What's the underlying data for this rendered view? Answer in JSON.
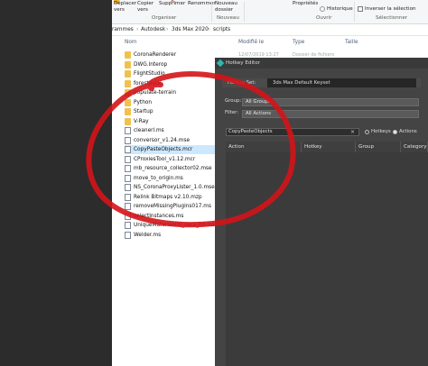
{
  "ribbon": {
    "move_to": "Déplacer\nvers",
    "copy_to": "Copier\nvers",
    "delete": "Supprimer",
    "rename": "Renommer",
    "new_folder": "Nouveau\ndossier",
    "properties": "Propriétés",
    "history": "Historique",
    "invert_selection": "Inverser la sélection",
    "group_organize": "Organiser",
    "group_new": "Nouveau",
    "group_open": "Ouvrir",
    "group_select": "Sélectionner"
  },
  "address": {
    "parts": [
      "rammes",
      "Autodesk",
      "3ds Max 2020",
      "scripts"
    ]
  },
  "columns": {
    "name": "Nom",
    "modified": "Modifié le",
    "type": "Type",
    "size": "Taille"
  },
  "faint_meta": {
    "date": "12/07/2019 13:27",
    "type": "Dossier de fichiers"
  },
  "files": [
    {
      "name": "CoronaRenderer",
      "kind": "folder"
    },
    {
      "name": "DWG.Interop",
      "kind": "folder"
    },
    {
      "name": "FlightStudio",
      "kind": "folder"
    },
    {
      "name": "forestpack",
      "kind": "folder"
    },
    {
      "name": "populate-terrain",
      "kind": "folder"
    },
    {
      "name": "Python",
      "kind": "folder"
    },
    {
      "name": "Startup",
      "kind": "folder"
    },
    {
      "name": "V-Ray",
      "kind": "folder"
    },
    {
      "name": "cleanerl.ms",
      "kind": "file"
    },
    {
      "name": "conversor_v1.24.mse",
      "kind": "file"
    },
    {
      "name": "CopyPasteObjects.mcr",
      "kind": "file"
    },
    {
      "name": "CProxiesTool_v1.12.mcr",
      "kind": "file"
    },
    {
      "name": "mb_resource_collector02.mse",
      "kind": "file"
    },
    {
      "name": "move_to_origin.ms",
      "kind": "file"
    },
    {
      "name": "NS_CoronaProxyLister_1.0.mse",
      "kind": "file"
    },
    {
      "name": "Relink Bitmaps v2.10.mzp",
      "kind": "file"
    },
    {
      "name": "removeMissingPlugins017.ms",
      "kind": "file"
    },
    {
      "name": "selectInstances.ms",
      "kind": "file"
    },
    {
      "name": "UniqueMaterialIDs_ver1_00.ms",
      "kind": "file"
    },
    {
      "name": "Welder.ms",
      "kind": "file"
    }
  ],
  "selected_file_index": 10,
  "hotkey_editor": {
    "title": "Hotkey Editor",
    "set_label": "Hotkey Set:",
    "set_value": "3ds Max Default Keyset",
    "group_label": "Group:",
    "group_value": "All Groups",
    "filter_label": "Filter:",
    "filter_value": "All Actions",
    "search_value": "CopyPasteObjects",
    "clear_symbol": "×",
    "radio_hotkeys": "Hotkeys",
    "radio_actions": "Actions",
    "selected_radio": "Actions",
    "table_headers": [
      "Action",
      "Hotkey",
      "Group",
      "Category"
    ]
  },
  "colors": {
    "annotation_red": "#d4141a",
    "folder_yellow": "#f1c14d",
    "selection_blue": "#cce8ff"
  }
}
